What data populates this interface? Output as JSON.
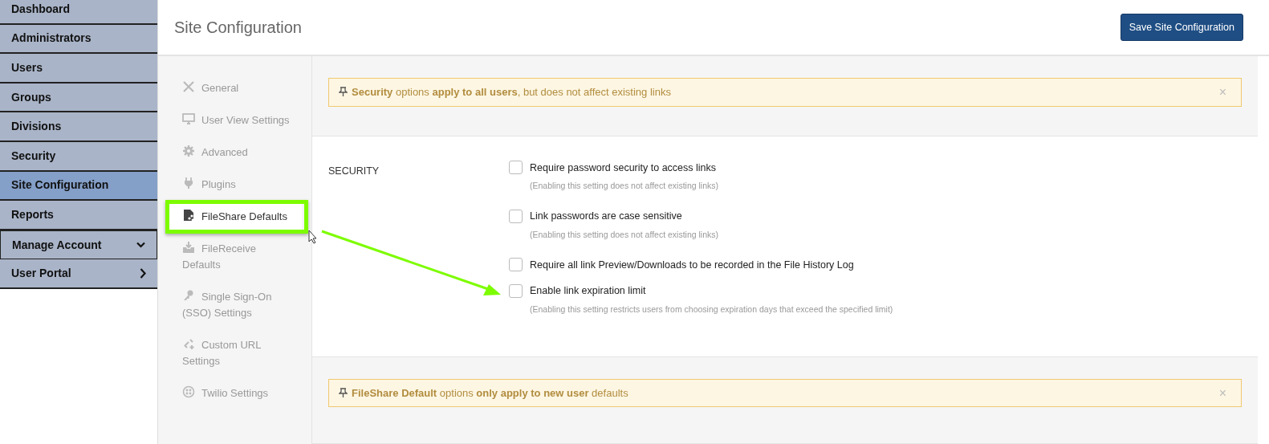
{
  "sidebar": {
    "items": [
      {
        "label": "Dashboard",
        "selected": false,
        "kind": "link"
      },
      {
        "label": "Administrators",
        "selected": false,
        "kind": "link"
      },
      {
        "label": "Users",
        "selected": false,
        "kind": "link"
      },
      {
        "label": "Groups",
        "selected": false,
        "kind": "link"
      },
      {
        "label": "Divisions",
        "selected": false,
        "kind": "link"
      },
      {
        "label": "Security",
        "selected": false,
        "kind": "link"
      },
      {
        "label": "Site Configuration",
        "selected": true,
        "kind": "link"
      },
      {
        "label": "Reports",
        "selected": false,
        "kind": "link"
      },
      {
        "label": "Manage Account",
        "selected": false,
        "kind": "dropdown"
      },
      {
        "label": "User Portal",
        "selected": false,
        "kind": "submenu"
      }
    ]
  },
  "header": {
    "title": "Site Configuration",
    "save_button": "Save Site Configuration"
  },
  "settings_nav": {
    "items": [
      {
        "label": "General",
        "selected": false
      },
      {
        "label": "User View Settings",
        "selected": false
      },
      {
        "label": "Advanced",
        "selected": false
      },
      {
        "label": "Plugins",
        "selected": false
      },
      {
        "label": "FileShare Defaults",
        "selected": true
      },
      {
        "label": "FileReceive Defaults",
        "selected": false
      },
      {
        "label": "Single Sign-On (SSO) Settings",
        "selected": false
      },
      {
        "label": "Custom URL Settings",
        "selected": false
      },
      {
        "label": "Twilio Settings",
        "selected": false
      }
    ]
  },
  "sections": [
    {
      "kind": "alert",
      "text": "**Security** options **apply to all users**, but does not affect existing links",
      "close": "×"
    },
    {
      "kind": "options",
      "heading": "SECURITY",
      "options": [
        {
          "label": "Require password security to access links",
          "hint": "(Enabling this setting does not affect existing links)",
          "checked": false
        },
        {
          "label": "Link passwords are case sensitive",
          "hint": "(Enabling this setting does not affect existing links)",
          "checked": false
        },
        {
          "label": "Require all link Preview/Downloads to be recorded in the File History Log",
          "checked": false
        },
        {
          "label": "Enable link expiration limit",
          "hint": "(Enabling this setting restricts users from choosing expiration days that exceed the specified limit)",
          "checked": false
        }
      ]
    },
    {
      "kind": "alert",
      "text": "**FileShare Default** options **only apply to new user** defaults",
      "close": "×"
    }
  ]
}
